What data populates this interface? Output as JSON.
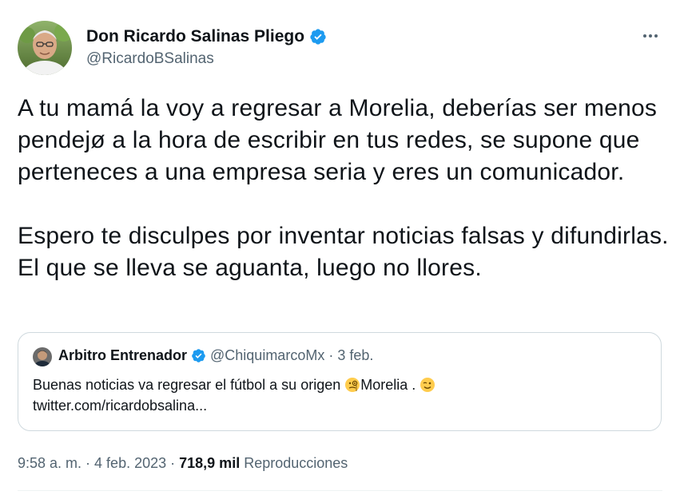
{
  "tweet": {
    "author": {
      "display_name": "Don Ricardo Salinas Pliego",
      "handle": "@RicardoBSalinas",
      "verified": true
    },
    "body": {
      "paragraph_1": "A tu mamá la voy a regresar a Morelia, deberías ser menos pendejø a la hora de escribir en tus redes, se supone que perteneces a una empresa seria y eres un comunicador.",
      "paragraph_2": "Espero te disculpes por inventar noticias falsas y difundirlas. El que se lleva se aguanta, luego no llores."
    },
    "quote": {
      "display_name": "Arbitro Entrenador",
      "handle": "@ChiquimarcoMx",
      "separator": "·",
      "date": "3 feb.",
      "text_before_emoji": "Buenas noticias va regresar el fútbol a su origen ",
      "text_after_emoji": "Morelia . ",
      "link": "twitter.com/ricardobsalina..."
    },
    "meta": {
      "time": "9:58 a. m.",
      "sep1": "·",
      "date": "4 feb. 2023",
      "sep2": "·",
      "views_count": "718,9 mil",
      "views_label": "Reproducciones"
    }
  },
  "icons": {
    "verified": "verified-badge-icon",
    "more": "more-horizontal-icon",
    "emoji_1": "face-with-monocle-emoji",
    "emoji_2": "winking-face-emoji"
  },
  "colors": {
    "text_primary": "#0f1419",
    "text_secondary": "#536471",
    "verified_blue": "#1d9bf0",
    "border": "#cfd9de"
  }
}
